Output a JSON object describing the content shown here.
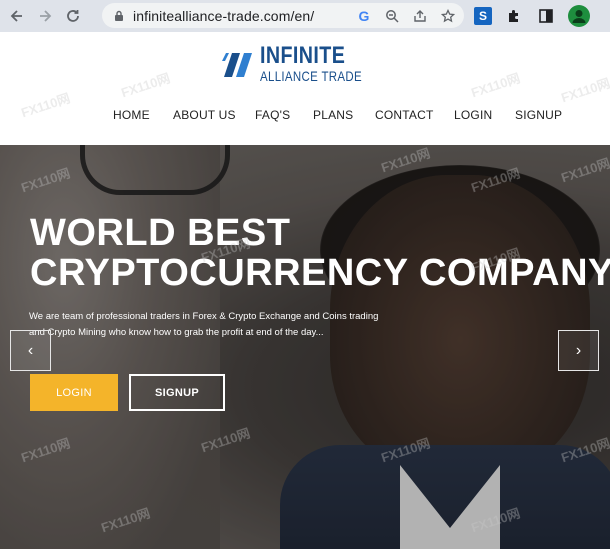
{
  "browser": {
    "url": "infinitealliance-trade.com/en/",
    "back_icon": "arrow-left-icon",
    "forward_icon": "arrow-right-icon",
    "reload_icon": "reload-icon",
    "omnibox_icons": [
      "google-icon",
      "zoom-icon",
      "share-icon",
      "star-icon"
    ],
    "extension_label": "S"
  },
  "site": {
    "logo_title": "INFINITE",
    "logo_subtitle": "ALLIANCE TRADE",
    "menu": [
      "HOME",
      "ABOUT US",
      "FAQ'S",
      "PLANS",
      "CONTACT",
      "LOGIN",
      "SIGNUP"
    ]
  },
  "hero": {
    "title_line1": "WORLD BEST",
    "title_line2": "CRYPTOCURRENCY COMPANY",
    "text_line1": "We are team of professional traders in Forex & Crypto Exchange and Coins trading",
    "text_line2": "and Crypto Mining who know how to grab the profit at end of the day...",
    "login_label": "LOGIN",
    "signup_label": "SIGNUP",
    "prev_arrow": "‹",
    "next_arrow": "›"
  },
  "colors": {
    "brand_blue": "#1a4f8b",
    "login_button": "#f4b42a"
  }
}
